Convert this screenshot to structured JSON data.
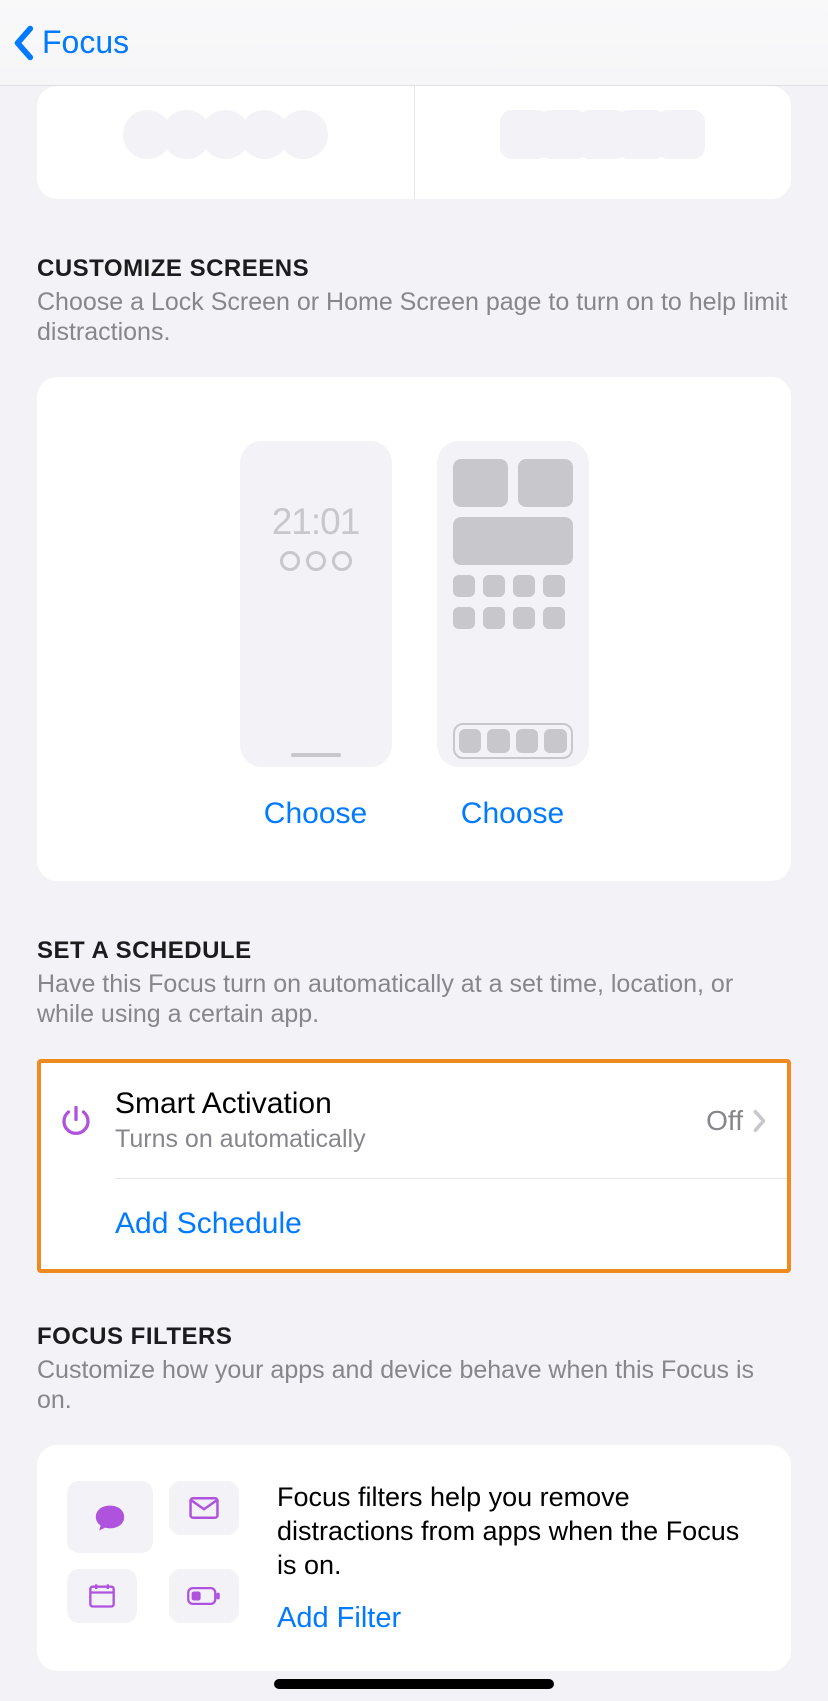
{
  "nav": {
    "back_label": "Focus"
  },
  "customize": {
    "title": "CUSTOMIZE SCREENS",
    "desc": "Choose a Lock Screen or Home Screen page to turn on to help limit distractions.",
    "lock_time": "21:01",
    "choose_lock": "Choose",
    "choose_home": "Choose"
  },
  "schedule": {
    "title": "SET A SCHEDULE",
    "desc": "Have this Focus turn on automatically at a set time, location, or while using a certain app.",
    "smart_title": "Smart Activation",
    "smart_sub": "Turns on automatically",
    "smart_value": "Off",
    "add": "Add Schedule"
  },
  "filters": {
    "title": "FOCUS FILTERS",
    "desc": "Customize how your apps and device behave when this Focus is on.",
    "help": "Focus filters help you remove distractions from apps when the Focus is on.",
    "add": "Add Filter"
  },
  "colors": {
    "accent": "#007aff",
    "purple": "#af52de",
    "orange": "#ee8a1f"
  }
}
